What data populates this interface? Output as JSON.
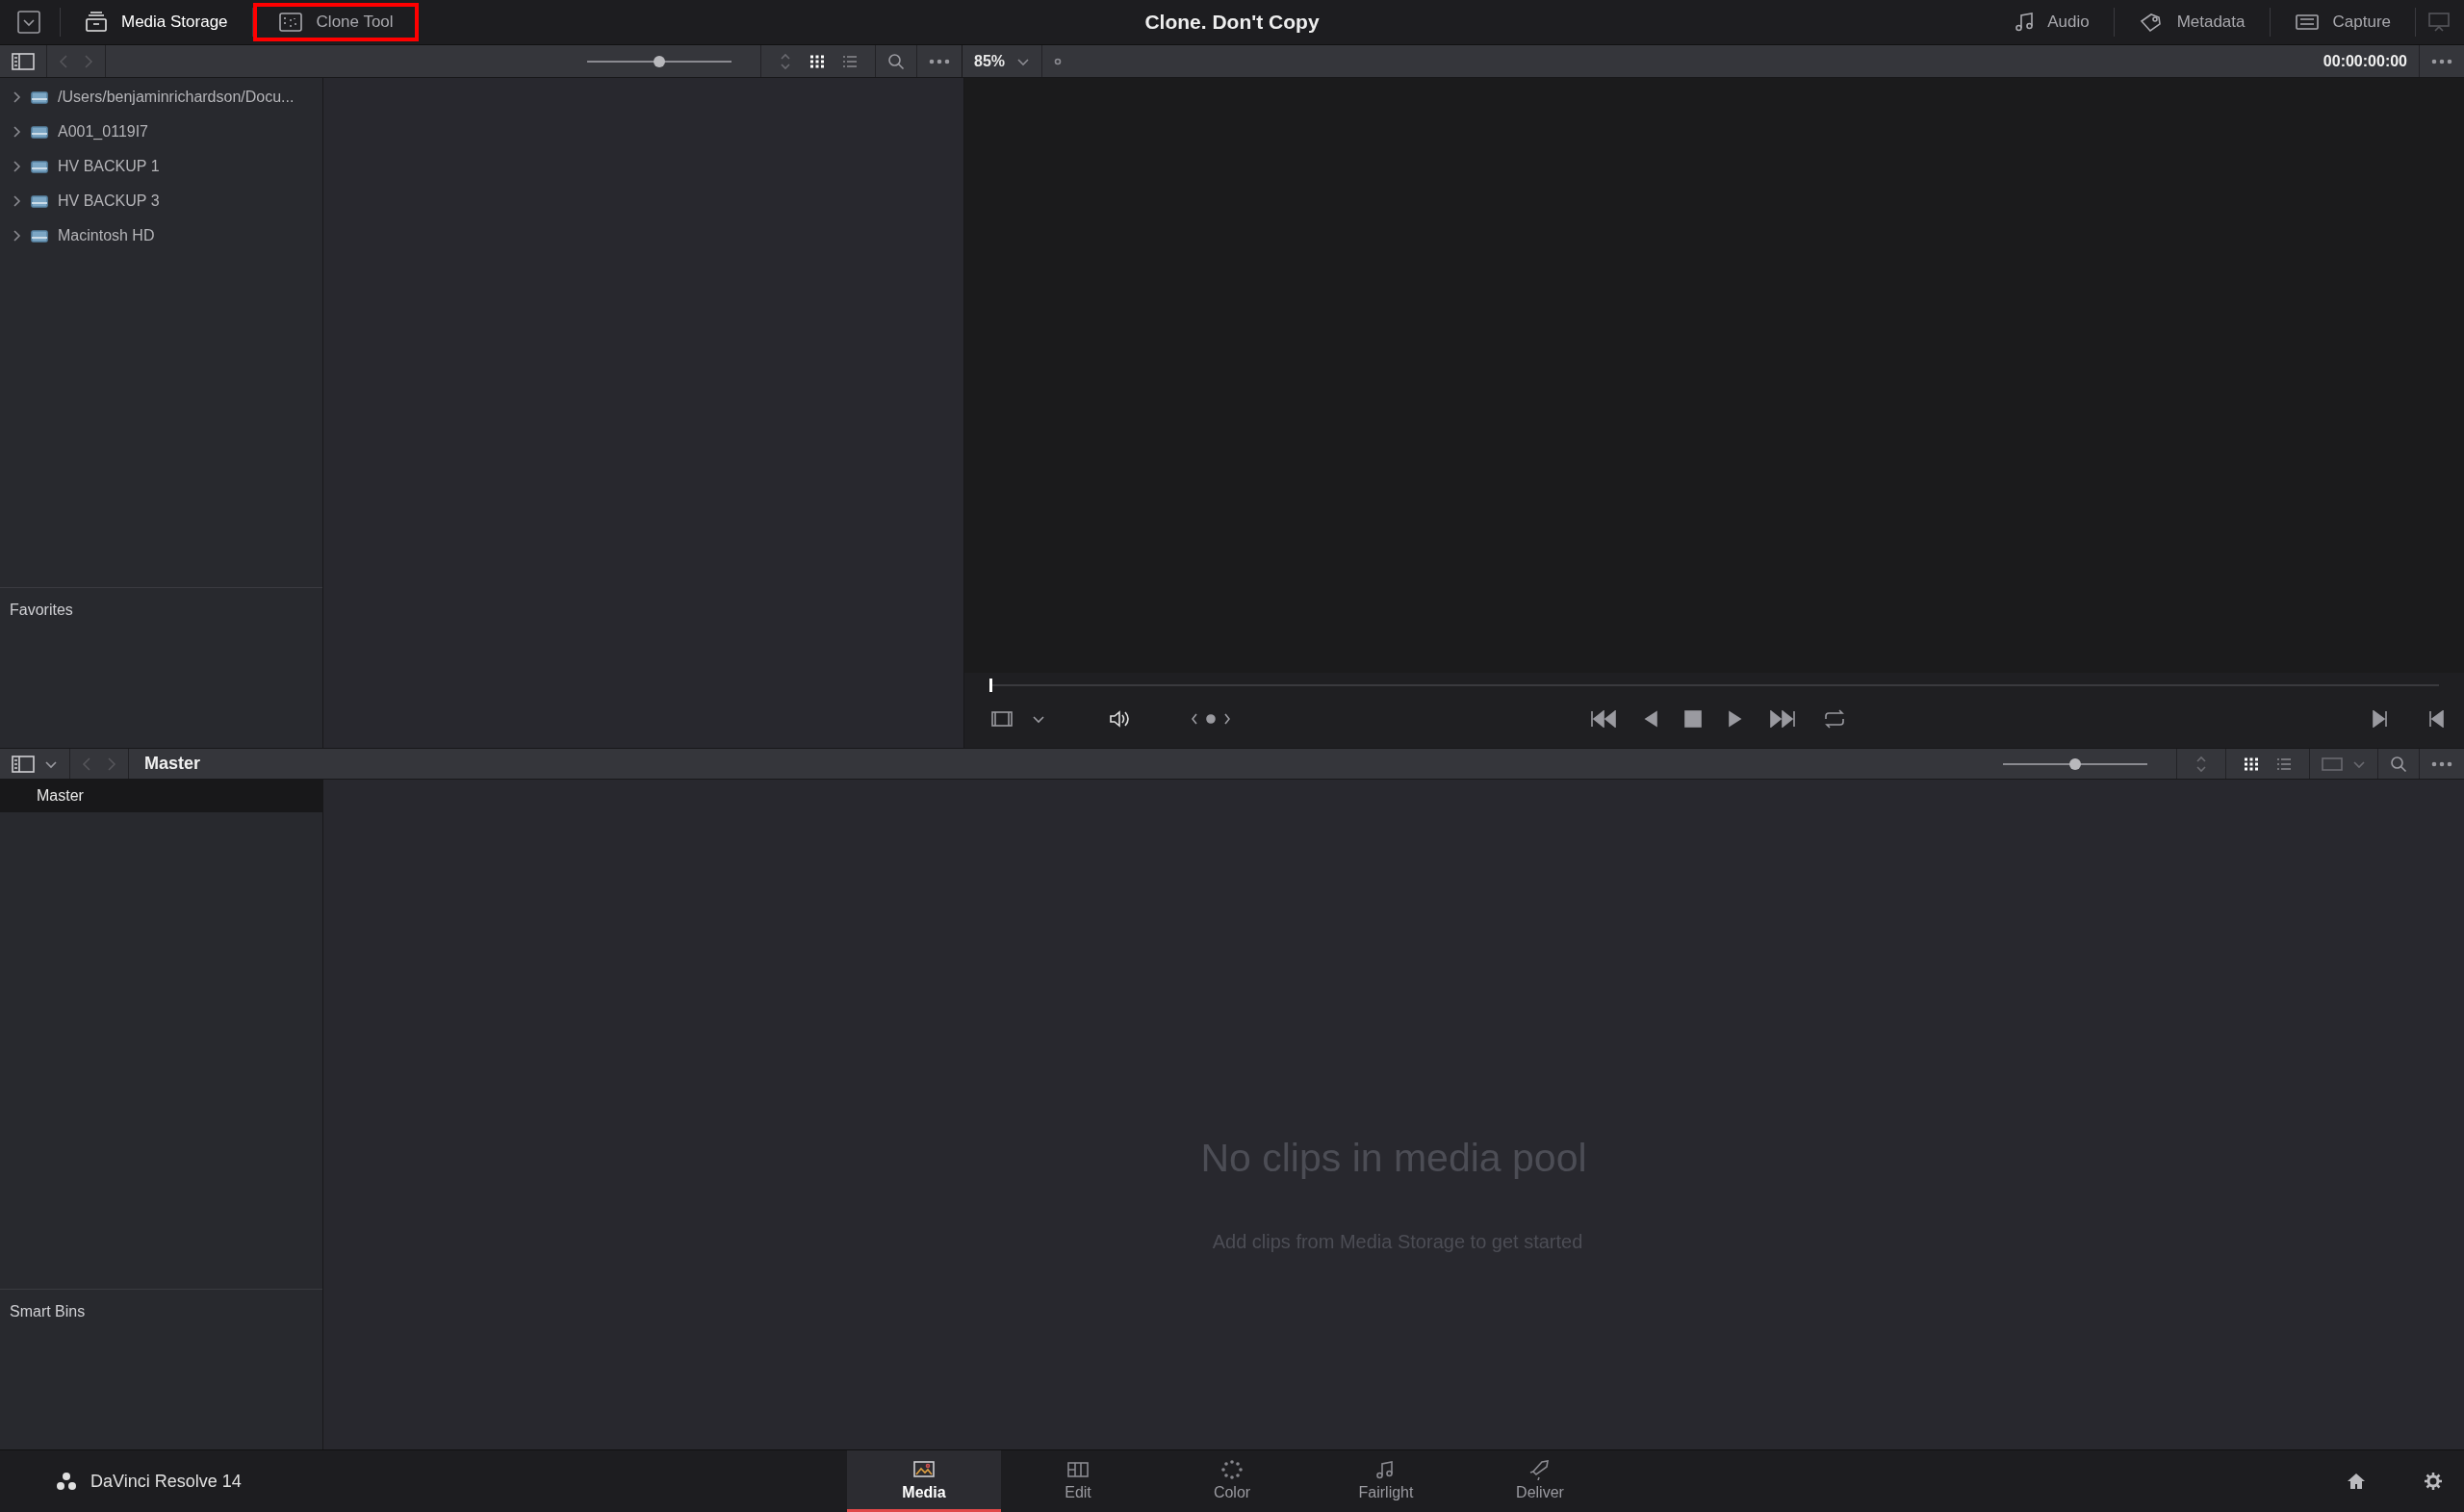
{
  "header": {
    "left_tabs": [
      {
        "label": "Media Storage",
        "kind": "storage",
        "selected": true,
        "highlighted": false
      },
      {
        "label": "Clone Tool",
        "kind": "clone",
        "selected": false,
        "highlighted": true
      }
    ],
    "project_title": "Clone. Don't Copy",
    "right_tabs": [
      {
        "label": "Audio",
        "kind": "audio",
        "selected": false
      },
      {
        "label": "Metadata",
        "kind": "metadata",
        "selected": false
      },
      {
        "label": "Capture",
        "kind": "capture",
        "selected": false
      }
    ]
  },
  "browser_toolbar": {
    "thumb_size": {
      "level": 0.5
    },
    "view_buttons": [
      {
        "kind": "grid",
        "selected": true
      },
      {
        "kind": "list",
        "selected": false
      }
    ]
  },
  "media_storage": {
    "locations": [
      {
        "label": "/Users/benjaminrichardson/Docu...",
        "expanded": false
      },
      {
        "label": "A001_0119I7",
        "expanded": false
      },
      {
        "label": "HV BACKUP 1",
        "expanded": false
      },
      {
        "label": "HV BACKUP 3",
        "expanded": false
      },
      {
        "label": "Macintosh HD",
        "expanded": false
      }
    ],
    "favorites_title": "Favorites"
  },
  "viewer": {
    "zoom": "85%",
    "timecode": "00:00:00:00",
    "scrubber": {
      "level": 0
    }
  },
  "media_pool": {
    "breadcrumb": "Master",
    "thumb_size": {
      "level": 0.5
    },
    "view_buttons": [
      {
        "kind": "grid",
        "selected": true
      },
      {
        "kind": "list",
        "selected": false
      }
    ],
    "bins": [
      {
        "label": "Master",
        "selected": true
      }
    ],
    "smart_bins_title": "Smart Bins",
    "empty_title": "No clips in media pool",
    "empty_hint": "Add clips from Media Storage to get started"
  },
  "footer": {
    "app_name": "DaVinci Resolve 14",
    "pages": [
      {
        "label": "Media",
        "kind": "media",
        "selected": true
      },
      {
        "label": "Edit",
        "kind": "edit",
        "selected": false
      },
      {
        "label": "Color",
        "kind": "color",
        "selected": false
      },
      {
        "label": "Fairlight",
        "kind": "fairlight",
        "selected": false
      },
      {
        "label": "Deliver",
        "kind": "deliver",
        "selected": false
      }
    ]
  }
}
